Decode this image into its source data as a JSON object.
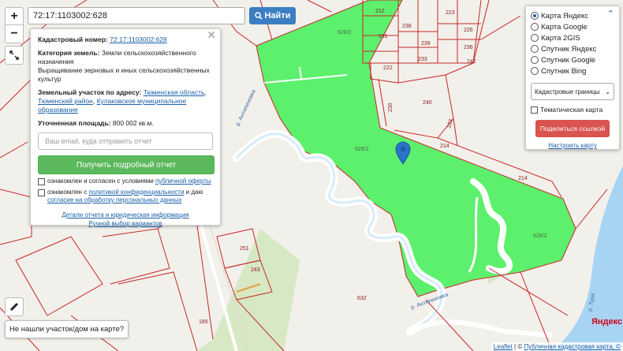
{
  "search": {
    "value": "72:17:1103002:628",
    "button_label": "Найти"
  },
  "zoom": {
    "in_label": "+",
    "out_label": "−"
  },
  "info": {
    "cadastral_label": "Кадастровый номер:",
    "cadastral_value": "72:17:1103002:628",
    "category_label": "Категория земель:",
    "category_value": "Земли сельскохозяйственного назначения",
    "usage_value": "Выращивание зерновых и иных сельскохозяйственных культур",
    "address_label": "Земельный участок по адресу:",
    "address_links": [
      "Тюменская область",
      "Тюменский район",
      "Кулаковское муниципальное образование"
    ],
    "area_label": "Уточненная площадь:",
    "area_value": "800 002 кв.м.",
    "email_placeholder": "Ваш email, куда отправить отчет",
    "report_button": "Получить подробный отчет",
    "agree1_text": "ознакомлен и согласен с условиями ",
    "agree1_link": "публичной оферты",
    "agree2_text": "ознакомлен с ",
    "agree2_link": "политикой конфиденциальности",
    "agree2_mid": " и даю ",
    "agree2_link2": "согласие на обработку персональных данных",
    "details_link": "Детали отчета и юридическая информация",
    "manual_link": "Ручной выбор вариантов"
  },
  "layers": {
    "options": [
      "Карта Яндекс",
      "Карта Google",
      "Карта 2GIS",
      "Спутник Яндекс",
      "Спутник Google",
      "Спутник Bing"
    ],
    "selected_index": 0,
    "select_value": "Кадастровые границы",
    "thematic_label": "Тематическая карта",
    "share_button": "Поделиться ссылкой",
    "settings_link": "Настроить карту"
  },
  "not_found_button": "Не нашли участок/дом на карте?",
  "attribution": {
    "leaflet": "Leaflet",
    "sep": " | © ",
    "cadastral": "Публичная кадастровая карта, ©"
  },
  "yandex_logo": "Яндекс",
  "map_labels": {
    "parcel": "628/2",
    "parcels": [
      "212",
      "231",
      "238",
      "239",
      "233",
      "223",
      "226",
      "236",
      "242",
      "222",
      "240",
      "230",
      "183",
      "214",
      "251",
      "243",
      "632",
      "185"
    ],
    "river1": "р. Антипиновка",
    "river2": "р. Антипиновка",
    "river3": "р. Тура"
  },
  "colors": {
    "parcel_fill": "#5df06d",
    "boundary": "#c62828",
    "water": "#a8d4f4",
    "search_btn": "#3b7fc2",
    "report_btn": "#5cb85c",
    "share_btn": "#d9534f"
  }
}
